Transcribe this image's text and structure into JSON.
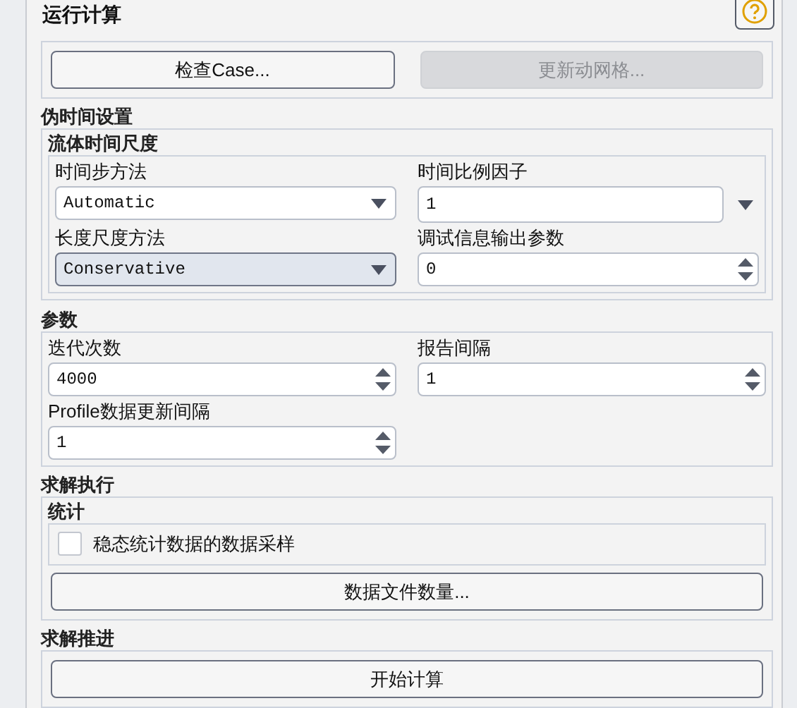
{
  "title": "运行计算",
  "top_buttons": [
    {
      "label": "检查Case...",
      "disabled": false
    },
    {
      "label": "更新动网格...",
      "disabled": true
    }
  ],
  "pseudo_time": {
    "title": "伪时间设置",
    "subgroup": {
      "title": "流体时间尺度",
      "fields": [
        {
          "label": "时间步方法",
          "kind": "dropdown",
          "value": "Automatic",
          "focused": false
        },
        {
          "label": "时间比例因子",
          "kind": "number_menu",
          "value": "1"
        },
        {
          "label": "长度尺度方法",
          "kind": "dropdown",
          "value": "Conservative",
          "focused": true
        },
        {
          "label": "调试信息输出参数",
          "kind": "spinner",
          "value": "0"
        }
      ]
    }
  },
  "parameters": {
    "title": "参数",
    "fields": [
      {
        "label": "迭代次数",
        "kind": "spinner",
        "value": "4000"
      },
      {
        "label": "报告间隔",
        "kind": "spinner",
        "value": "1"
      },
      {
        "label": "Profile数据更新间隔",
        "kind": "spinner",
        "value": "1"
      }
    ]
  },
  "solution": {
    "title": "求解执行",
    "subgroup": {
      "title": "统计",
      "checkbox": {
        "label": "稳态统计数据的数据采样",
        "checked": false
      },
      "button": "数据文件数量..."
    }
  },
  "advance": {
    "title": "求解推进",
    "button": "开始计算"
  }
}
